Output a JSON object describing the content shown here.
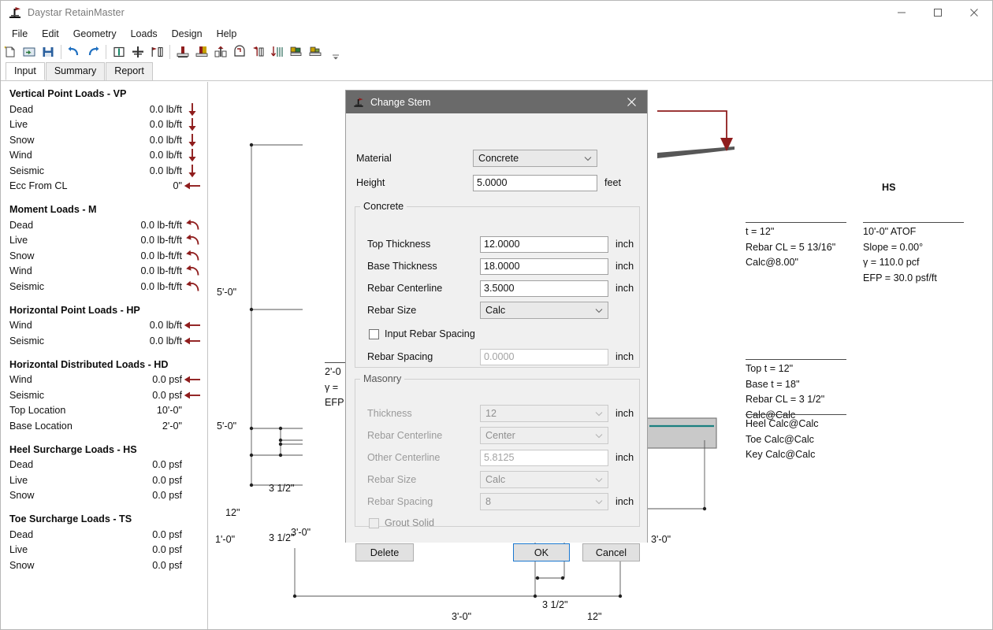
{
  "window": {
    "title": "Daystar RetainMaster",
    "app_icon": "retain-wall-icon",
    "minimize": "minimize-icon",
    "maximize": "maximize-icon",
    "close": "close-icon"
  },
  "menubar": {
    "items": [
      "File",
      "Edit",
      "Geometry",
      "Loads",
      "Design",
      "Help"
    ]
  },
  "toolbar": {
    "icons": [
      "new-file-icon",
      "open-file-icon",
      "save-icon",
      "undo-icon",
      "redo-icon",
      "stem-icon",
      "footing-icon",
      "surcharge-icon",
      "heel-icon",
      "toe-icon",
      "soil-icon",
      "key-icon",
      "lateral-load-icon",
      "seismic-icon",
      "restrained-icon",
      "sloped-icon"
    ],
    "overflow": "toolbar-overflow-icon"
  },
  "tabs": [
    {
      "label": "Input",
      "active": true
    },
    {
      "label": "Summary",
      "active": false
    },
    {
      "label": "Report",
      "active": false
    }
  ],
  "loads_panel": {
    "groups": [
      {
        "title": "Vertical Point Loads - VP",
        "rows": [
          {
            "label": "Dead",
            "value": "0.0 lb/ft",
            "arrow": "arrow-down-icon"
          },
          {
            "label": "Live",
            "value": "0.0 lb/ft",
            "arrow": "arrow-down-icon"
          },
          {
            "label": "Snow",
            "value": "0.0 lb/ft",
            "arrow": "arrow-down-icon"
          },
          {
            "label": "Wind",
            "value": "0.0 lb/ft",
            "arrow": "arrow-down-icon"
          },
          {
            "label": "Seismic",
            "value": "0.0 lb/ft",
            "arrow": "arrow-down-icon"
          },
          {
            "label": "Ecc From CL",
            "value": "0\"",
            "arrow": "arrow-left-icon"
          }
        ]
      },
      {
        "title": "Moment Loads - M",
        "rows": [
          {
            "label": "Dead",
            "value": "0.0 lb-ft/ft",
            "arrow": "moment-curve-icon"
          },
          {
            "label": "Live",
            "value": "0.0 lb-ft/ft",
            "arrow": "moment-curve-icon"
          },
          {
            "label": "Snow",
            "value": "0.0 lb-ft/ft",
            "arrow": "moment-curve-icon"
          },
          {
            "label": "Wind",
            "value": "0.0 lb-ft/ft",
            "arrow": "moment-curve-icon"
          },
          {
            "label": "Seismic",
            "value": "0.0 lb-ft/ft",
            "arrow": "moment-curve-icon"
          }
        ]
      },
      {
        "title": "Horizontal Point Loads - HP",
        "rows": [
          {
            "label": "Wind",
            "value": "0.0 lb/ft",
            "arrow": "arrow-left-icon"
          },
          {
            "label": "Seismic",
            "value": "0.0 lb/ft",
            "arrow": "arrow-left-icon"
          }
        ]
      },
      {
        "title": "Horizontal Distributed Loads - HD",
        "rows": [
          {
            "label": "Wind",
            "value": "0.0 psf",
            "arrow": "arrow-left-icon"
          },
          {
            "label": "Seismic",
            "value": "0.0 psf",
            "arrow": "arrow-left-icon"
          },
          {
            "label": "Top Location",
            "value": "10'-0\"",
            "arrow": ""
          },
          {
            "label": "Base Location",
            "value": "2'-0\"",
            "arrow": ""
          }
        ]
      },
      {
        "title": "Heel Surcharge Loads - HS",
        "rows": [
          {
            "label": "Dead",
            "value": "0.0 psf",
            "arrow": ""
          },
          {
            "label": "Live",
            "value": "0.0 psf",
            "arrow": ""
          },
          {
            "label": "Snow",
            "value": "0.0 psf",
            "arrow": ""
          }
        ]
      },
      {
        "title": "Toe Surcharge Loads - TS",
        "rows": [
          {
            "label": "Dead",
            "value": "0.0 psf",
            "arrow": ""
          },
          {
            "label": "Live",
            "value": "0.0 psf",
            "arrow": ""
          },
          {
            "label": "Snow",
            "value": "0.0 psf",
            "arrow": ""
          }
        ]
      }
    ]
  },
  "canvas": {
    "load_label_hs": "HS",
    "dimensions": {
      "stem_upper": "5'-0\"",
      "stem_lower": "5'-0\"",
      "footing_thickness": "12\"",
      "key_depth": "1'-0\"",
      "rebar_cover_top": "3 1/2\"",
      "rebar_cover_bottom": "3 1/2\"",
      "key_cover": "3 1/2\"",
      "heel_width": "3'-0\"",
      "toe_width": "3'-0\"",
      "stem_base_width": "12\"",
      "embed_depth": "3'-0\"",
      "soil_depth_partial": "2'-0",
      "gamma_partial": "γ =",
      "efp_partial": "EFP",
      "inner_bottom": "3'-0\""
    },
    "annotations": {
      "stem_top": [
        "t = 12\"",
        "Rebar CL = 5 13/16\"",
        "Calc@8.00\""
      ],
      "soil": [
        "10'-0\" ATOF",
        "Slope = 0.00°",
        "γ = 110.0 pcf",
        "EFP = 30.0 psf/ft"
      ],
      "stem_lower": [
        "Top t = 12\"",
        "Base t = 18\"",
        "Rebar CL = 3 1/2\"",
        "Calc@Calc"
      ],
      "footing": [
        "Heel Calc@Calc",
        "Toe Calc@Calc",
        "Key Calc@Calc"
      ]
    },
    "colors": {
      "load_arrow": "#8f1d1d",
      "rebar": "#1a8080",
      "soil_fill": "#3a3a3a",
      "concrete_fill": "#c9c9c9"
    }
  },
  "dialog": {
    "title": "Change Stem",
    "title_icon": "retain-wall-icon",
    "close_icon": "close-icon",
    "material": {
      "label": "Material",
      "value": "Concrete",
      "chevron": "chevron-down-icon"
    },
    "height": {
      "label": "Height",
      "value": "5.0000",
      "unit": "feet"
    },
    "concrete": {
      "legend": "Concrete",
      "top_thickness": {
        "label": "Top Thickness",
        "value": "12.0000",
        "unit": "inch"
      },
      "base_thickness": {
        "label": "Base Thickness",
        "value": "18.0000",
        "unit": "inch"
      },
      "rebar_centerline": {
        "label": "Rebar Centerline",
        "value": "3.5000",
        "unit": "inch"
      },
      "rebar_size": {
        "label": "Rebar Size",
        "value": "Calc",
        "chevron": "chevron-down-icon"
      },
      "input_rebar_spacing": {
        "label": "Input Rebar Spacing",
        "checked": false
      },
      "rebar_spacing": {
        "label": "Rebar Spacing",
        "value": "0.0000",
        "unit": "inch"
      }
    },
    "masonry": {
      "legend": "Masonry",
      "thickness": {
        "label": "Thickness",
        "value": "12",
        "unit": "inch",
        "chevron": "chevron-down-icon"
      },
      "rebar_centerline": {
        "label": "Rebar Centerline",
        "value": "Center",
        "chevron": "chevron-down-icon"
      },
      "other_centerline": {
        "label": "Other Centerline",
        "value": "5.8125",
        "unit": "inch"
      },
      "rebar_size": {
        "label": "Rebar Size",
        "value": "Calc",
        "chevron": "chevron-down-icon"
      },
      "rebar_spacing": {
        "label": "Rebar Spacing",
        "value": "8",
        "unit": "inch",
        "chevron": "chevron-down-icon"
      },
      "grout_solid": {
        "label": "Grout Solid",
        "checked": false
      }
    },
    "buttons": {
      "delete": "Delete",
      "ok": "OK",
      "cancel": "Cancel"
    }
  }
}
